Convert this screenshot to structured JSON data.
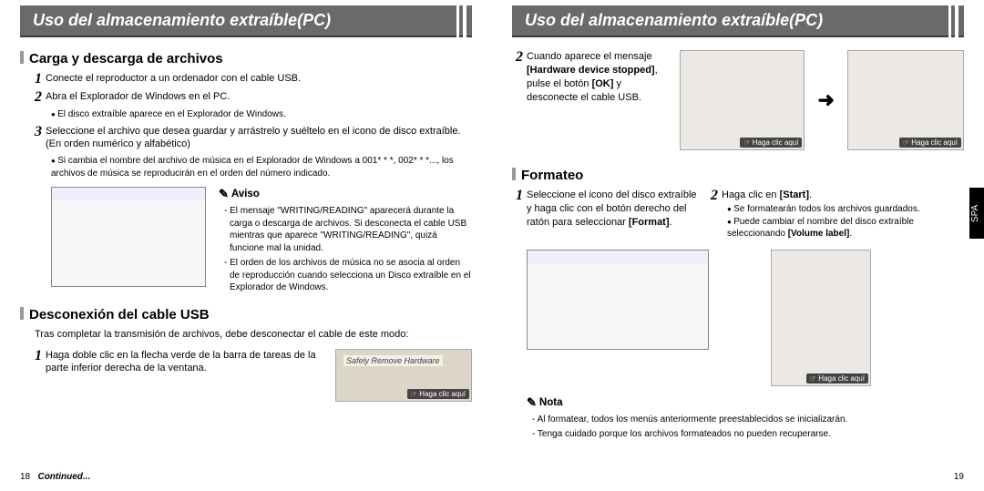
{
  "header_left": "Uso del almacenamiento extraíble(PC)",
  "header_right": "Uso del almacenamiento extraíble(PC)",
  "spa_tab": "SPA",
  "page_left_num": "18",
  "page_right_num": "19",
  "continued": "Continued...",
  "left": {
    "sec1_title": "Carga y descarga de archivos",
    "s1": "Conecte el reproductor a un ordenador con el cable USB.",
    "s2": "Abra el Explorador de Windows en el PC.",
    "s2_b1": "El disco extraíble aparece en el Explorador de Windows.",
    "s3": "Seleccione el archivo que desea guardar y arrástrelo y suéltelo en el icono de disco extraíble. (En orden numérico y alfabético)",
    "s3_b1": "Si cambia el nombre del archivo de música en el Explorador de Windows a 001* * *, 002* * *..., los archivos de música se reproducirán en el orden del número indicado.",
    "aviso_label": "Aviso",
    "aviso1": "- El mensaje \"WRITING/READING\" aparecerá durante la carga o descarga de archivos. Si desconecta el cable USB mientras que aparece \"WRITING/READING\", quizá funcione mal la unidad.",
    "aviso2": "- El orden de los archivos de música no se asocia al orden de reproducción cuando selecciona un Disco extraíble en el Explorador de Windows.",
    "sec2_title": "Desconexión del cable USB",
    "sec2_intro": "Tras completar la transmisión de archivos, debe desconectar el cable de este modo:",
    "sec2_s1": "Haga doble clic en la flecha verde de la barra de tareas de la parte inferior derecha de la ventana.",
    "safely_remove": "Safely Remove Hardware",
    "img_caption": "Haga clic aquí"
  },
  "right": {
    "s2_top": "Cuando aparece el mensaje [Hardware device stopped], pulse el botón [OK] y desconecte el cable USB.",
    "s2_top_prefix": "Cuando aparece el mensaje ",
    "s2_top_bold1": "[Hardware device stopped]",
    "s2_top_mid": ", pulse el botón ",
    "s2_top_bold2": "[OK]",
    "s2_top_suffix": " y desconecte el cable USB.",
    "img_caption": "Haga clic aquí",
    "sec3_title": "Formateo",
    "f_s1_prefix": "Seleccione el icono del disco extraíble y haga clic con el botón derecho del ratón para selec­cionar ",
    "f_s1_bold": "[Format]",
    "f_s1_suffix": ".",
    "f_s2_prefix": "Haga clic en ",
    "f_s2_bold": "[Start]",
    "f_s2_suffix": ".",
    "f_s2_b1": "Se formatearán todos los archivos guardados.",
    "f_s2_b2_prefix": "Puede cambiar el nombre del disco extraíble seleccionando ",
    "f_s2_b2_bold": "[Volume label]",
    "f_s2_b2_suffix": ".",
    "nota_label": "Nota",
    "nota1": "- Al formatear, todos los menús anteriormente preestablecidos se inicializarán.",
    "nota2": "- Tenga cuidado porque los archivos formateados no pueden recuperarse."
  }
}
